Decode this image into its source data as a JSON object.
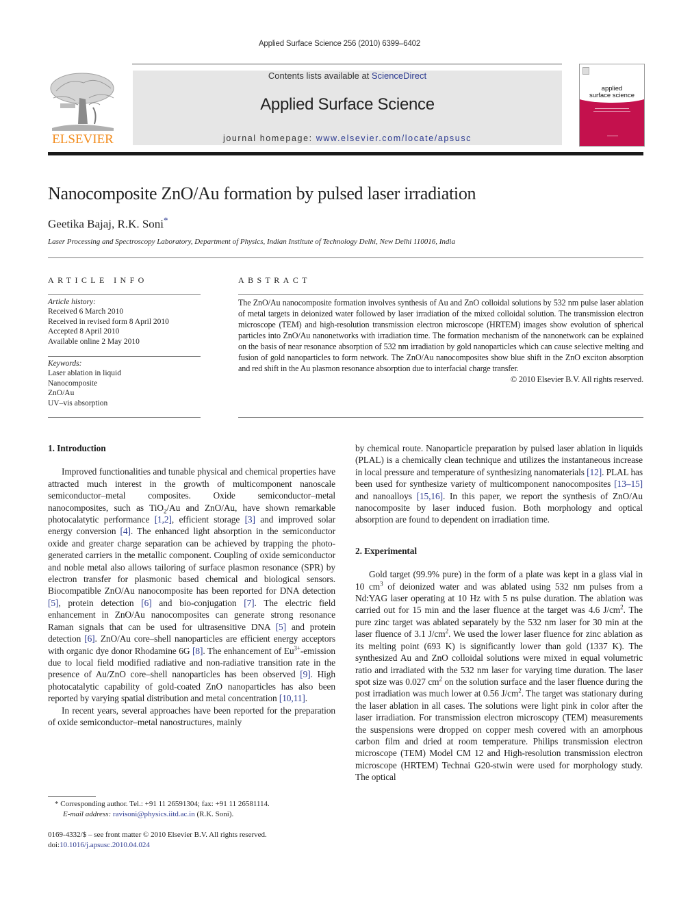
{
  "header": {
    "citation": "Applied Surface Science 256 (2010) 6399–6402",
    "contents_prefix": "Contents lists available at ",
    "contents_link": "ScienceDirect",
    "journal_title": "Applied Surface Science",
    "homepage_prefix": "journal homepage: ",
    "homepage_link": "www.elsevier.com/locate/apsusc",
    "publisher_logo_text": "ELSEVIER",
    "cover_title_line1": "applied",
    "cover_title_line2": "surface science",
    "colors": {
      "link": "#2b3990",
      "elsevier_orange": "#f28b1b",
      "cover_magenta": "#c4114d",
      "banner_gray": "#e6e6e6"
    }
  },
  "article": {
    "title": "Nanocomposite ZnO/Au formation by pulsed laser irradiation",
    "authors": "Geetika Bajaj, R.K. Soni",
    "corresponding_marker": "*",
    "affiliation": "Laser Processing and Spectroscopy Laboratory, Department of Physics, Indian Institute of Technology Delhi, New Delhi 110016, India"
  },
  "article_info": {
    "label": "ARTICLE INFO",
    "history_label": "Article history:",
    "history": [
      "Received 6 March 2010",
      "Received in revised form 8 April 2010",
      "Accepted 8 April 2010",
      "Available online 2 May 2010"
    ],
    "keywords_label": "Keywords:",
    "keywords": [
      "Laser ablation in liquid",
      "Nanocomposite",
      "ZnO/Au",
      "UV–vis absorption"
    ]
  },
  "abstract": {
    "label": "ABSTRACT",
    "text": "The ZnO/Au nanocomposite formation involves synthesis of Au and ZnO colloidal solutions by 532 nm pulse laser ablation of metal targets in deionized water followed by laser irradiation of the mixed colloidal solution. The transmission electron microscope (TEM) and high-resolution transmission electron microscope (HRTEM) images show evolution of spherical particles into ZnO/Au nanonetworks with irradiation time. The formation mechanism of the nanonetwork can be explained on the basis of near resonance absorption of 532 nm irradiation by gold nanoparticles which can cause selective melting and fusion of gold nanoparticles to form network. The ZnO/Au nanocomposites show blue shift in the ZnO exciton absorption and red shift in the Au plasmon resonance absorption due to interfacial charge transfer.",
    "copyright": "© 2010 Elsevier B.V. All rights reserved."
  },
  "introduction": {
    "heading": "1.  Introduction",
    "p1": [
      "Improved functionalities and tunable physical and chemical properties have attracted much interest in the growth of multicomponent nanoscale semiconductor–metal composites. Oxide semiconductor–metal nanocomposites, such as TiO",
      "2",
      "/Au and ZnO/Au, have shown remarkable photocalatytic performance ",
      "[1,2]",
      ", efficient storage ",
      "[3]",
      " and improved solar energy conversion ",
      "[4]",
      ". The enhanced light absorption in the semiconductor oxide and greater charge separation can be achieved by trapping the photo-generated carriers in the metallic component. Coupling of oxide semiconductor and noble metal also allows tailoring of surface plasmon resonance (SPR) by electron transfer for plasmonic based chemical and biological sensors. Biocompatible ZnO/Au nanocomposite has been reported for DNA detection ",
      "[5]",
      ", protein detection ",
      "[6]",
      " and bio-conjugation ",
      "[7]",
      ". The electric field enhancement in ZnO/Au nanocomposites can generate strong resonance Raman signals that can be used for ultrasensitive DNA ",
      "[5]",
      " and protein detection ",
      "[6]",
      ". ZnO/Au core–shell nanoparticles are efficient energy acceptors with organic dye donor Rhodamine 6G ",
      "[8]",
      ". The enhancement of Eu",
      "3+",
      "-emission due to local field modified radiative and non-radiative transition rate in the presence of Au/ZnO core–shell nanoparticles has been observed ",
      "[9]",
      ". High photocatalytic capability of gold-coated ZnO nanoparticles has also been reported by varying spatial distribution and metal concentration ",
      "[10,11]",
      "."
    ],
    "p2_left": "In recent years, several approaches have been reported for the preparation of oxide semiconductor–metal nanostructures, mainly",
    "p2_right": [
      "by chemical route. Nanoparticle preparation by pulsed laser ablation in liquids (PLAL) is a chemically clean technique and utilizes the instantaneous increase in local pressure and temperature of synthesizing nanomaterials ",
      "[12]",
      ". PLAL has been used for synthesize variety of multicomponent nanocomposites ",
      "[13–15]",
      " and nanoalloys ",
      "[15,16]",
      ". In this paper, we report the synthesis of ZnO/Au nanocomposite by laser induced fusion. Both morphology and optical absorption are found to dependent on irradiation time."
    ]
  },
  "experimental": {
    "heading": "2.  Experimental",
    "p1": [
      "Gold target (99.9% pure) in the form of a plate was kept in a glass vial in 10 cm",
      "3",
      " of deionized water and was ablated using 532 nm pulses from a Nd:YAG laser operating at 10 Hz with 5 ns pulse duration. The ablation was carried out for 15 min and the laser fluence at the target was 4.6 J/cm",
      "2",
      ". The pure zinc target was ablated separately by the 532 nm laser for 30 min at the laser fluence of 3.1 J/cm",
      "2",
      ". We used the lower laser fluence for zinc ablation as its melting point (693 K) is significantly lower than gold (1337 K). The synthesized Au and ZnO colloidal solutions were mixed in equal volumetric ratio and irradiated with the 532 nm laser for varying time duration. The laser spot size was 0.027 cm",
      "2",
      " on the solution surface and the laser fluence during the post irradiation was much lower at 0.56 J/cm",
      "2",
      ". The target was stationary during the laser ablation in all cases. The solutions were light pink in color after the laser irradiation. For transmission electron microscopy (TEM) measurements the suspensions were dropped on copper mesh covered with an amorphous carbon film and dried at room temperature. Philips transmission electron microscope (TEM) Model CM 12 and High-resolution transmission electron microscope (HRTEM) Technai G20-stwin were used for morphology study. The optical"
    ]
  },
  "footnote": {
    "marker": "*",
    "text": " Corresponding author. Tel.: +91 11 26591304; fax: +91 11 26581114.",
    "email_label": "E-mail address:",
    "email": "ravisoni@physics.iitd.ac.in",
    "email_suffix": " (R.K. Soni)."
  },
  "front_matter": {
    "issn_line": "0169-4332/$ – see front matter © 2010 Elsevier B.V. All rights reserved.",
    "doi_prefix": "doi:",
    "doi": "10.1016/j.apsusc.2010.04.024"
  }
}
